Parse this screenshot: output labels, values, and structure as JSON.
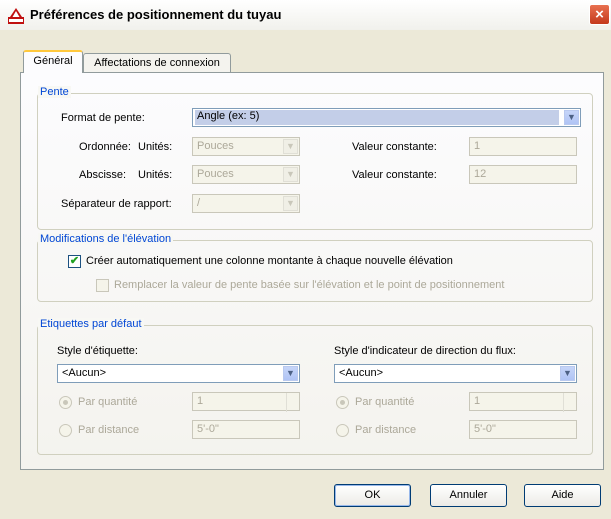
{
  "window": {
    "title": "Préférences de positionnement du tuyau",
    "close_glyph": "×",
    "app_icon": "autocad-mep-icon"
  },
  "tabs": [
    {
      "label": "Général",
      "active": true
    },
    {
      "label": "Affectations de connexion",
      "active": false
    }
  ],
  "pente": {
    "title": "Pente",
    "format_label": "Format de pente:",
    "format_value": "Angle (ex: 5)",
    "ordonnee_label": "Ordonnée:",
    "abscisse_label": "Abscisse:",
    "unites_label": "Unités:",
    "ordonnee_units": "Pouces",
    "abscisse_units": "Pouces",
    "valeur_constante_label": "Valeur constante:",
    "ordonnee_constant": "1",
    "abscisse_constant": "12",
    "separateur_label": "Séparateur de rapport:",
    "separateur_value": "/"
  },
  "elevation": {
    "title": "Modifications de l'élévation",
    "create_riser_label": "Créer automatiquement une colonne montante à chaque nouvelle élévation",
    "create_riser_checked": true,
    "replace_slope_label": "Remplacer la valeur de pente basée sur l'élévation et le point de positionnement",
    "replace_slope_checked": false
  },
  "labels": {
    "title": "Etiquettes par défaut",
    "label_style_label": "Style d'étiquette:",
    "label_style_value": "<Aucun>",
    "flow_style_label": "Style d'indicateur de direction du flux:",
    "flow_style_value": "<Aucun>",
    "by_quantity_label": "Par quantité",
    "by_distance_label": "Par distance",
    "left_quantity": "1",
    "left_distance": "5'-0\"",
    "right_quantity": "1",
    "right_distance": "5'-0\""
  },
  "buttons": {
    "ok": "OK",
    "cancel": "Annuler",
    "help": "Aide"
  },
  "colors": {
    "group_title": "#0046d5",
    "dialog_bg": "#ece9d8",
    "tab_highlight": "#ffc83c"
  }
}
